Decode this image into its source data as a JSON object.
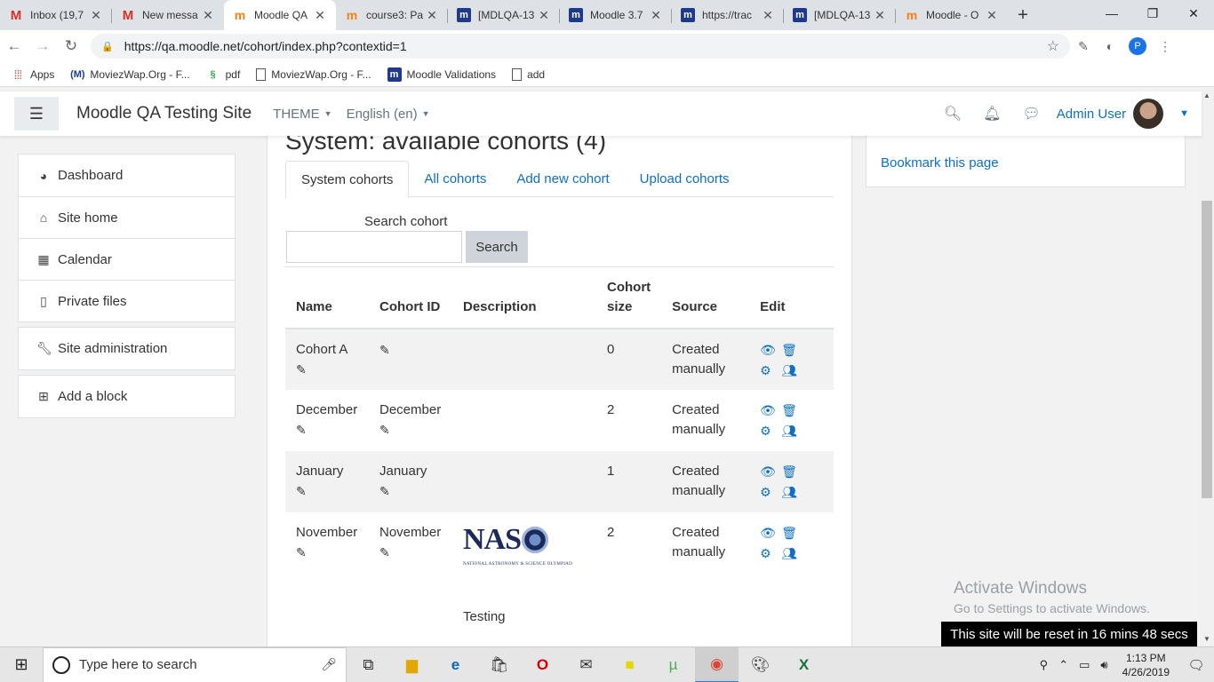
{
  "browser": {
    "tabs": [
      {
        "title": "Inbox (19,7",
        "icon": "gmail-icon"
      },
      {
        "title": "New messa",
        "icon": "gmail-icon"
      },
      {
        "title": "Moodle QA",
        "icon": "moodle-icon",
        "active": true
      },
      {
        "title": "course3: Pa",
        "icon": "moodle-icon"
      },
      {
        "title": "[MDLQA-13",
        "icon": "tracker-icon"
      },
      {
        "title": "Moodle 3.7",
        "icon": "tracker-icon"
      },
      {
        "title": "https://trac",
        "icon": "tracker-icon"
      },
      {
        "title": "[MDLQA-13",
        "icon": "tracker-icon"
      },
      {
        "title": "Moodle - O",
        "icon": "moodle-icon"
      }
    ],
    "url": "https://qa.moodle.net/cohort/index.php?contextid=1",
    "profile_initial": "P",
    "bookmarks": [
      {
        "label": "Apps",
        "icon": "apps-icon"
      },
      {
        "label": "MoviezWap.Org - F...",
        "icon": "moviezwap-icon"
      },
      {
        "label": "pdf",
        "icon": "pdf-icon"
      },
      {
        "label": "MoviezWap.Org - F...",
        "icon": "page-icon"
      },
      {
        "label": "Moodle Validations",
        "icon": "tracker-icon"
      },
      {
        "label": "add",
        "icon": "page-icon"
      }
    ]
  },
  "navbar": {
    "site_name": "Moodle QA Testing Site",
    "theme_label": "THEME",
    "language_label": "English (en)",
    "user_name": "Admin User"
  },
  "leftnav": {
    "group1": [
      {
        "label": "Dashboard",
        "icon": "dashboard-icon"
      },
      {
        "label": "Site home",
        "icon": "home-icon"
      },
      {
        "label": "Calendar",
        "icon": "calendar-icon"
      },
      {
        "label": "Private files",
        "icon": "file-icon"
      }
    ],
    "site_admin": "Site administration",
    "add_block": "Add a block"
  },
  "main": {
    "title": "System: available cohorts (4)",
    "tabs": [
      "System cohorts",
      "All cohorts",
      "Add new cohort",
      "Upload cohorts"
    ],
    "search_label": "Search cohort",
    "search_value": "",
    "search_button": "Search",
    "table": {
      "headers": [
        "Name",
        "Cohort ID",
        "Description",
        "Cohort size",
        "Source",
        "Edit"
      ],
      "header_size_line1": "Cohort",
      "header_size_line2": "size",
      "rows": [
        {
          "name": "Cohort A",
          "cohort_id": "",
          "description": "",
          "size": "0",
          "source1": "Created",
          "source2": "manually"
        },
        {
          "name": "December",
          "cohort_id": "December",
          "description": "",
          "size": "2",
          "source1": "Created",
          "source2": "manually"
        },
        {
          "name": "January",
          "cohort_id": "January",
          "description": "",
          "size": "1",
          "source1": "Created",
          "source2": "manually"
        },
        {
          "name": "November",
          "cohort_id": "November",
          "description": "Testing",
          "size": "2",
          "source1": "Created",
          "source2": "manually"
        }
      ],
      "naso_logo": "NAS",
      "naso_subtitle": "NATIONAL ASTRONOMY & SCIENCE OLYMPIAD"
    }
  },
  "rightblock": {
    "bookmark_link": "Bookmark this page"
  },
  "overlay": {
    "activate_title": "Activate Windows",
    "activate_sub": "Go to Settings to activate Windows.",
    "reset_notice": "This site will be reset in 16 mins 48 secs"
  },
  "taskbar": {
    "search_placeholder": "Type here to search",
    "time": "1:13 PM",
    "date": "4/26/2019"
  }
}
